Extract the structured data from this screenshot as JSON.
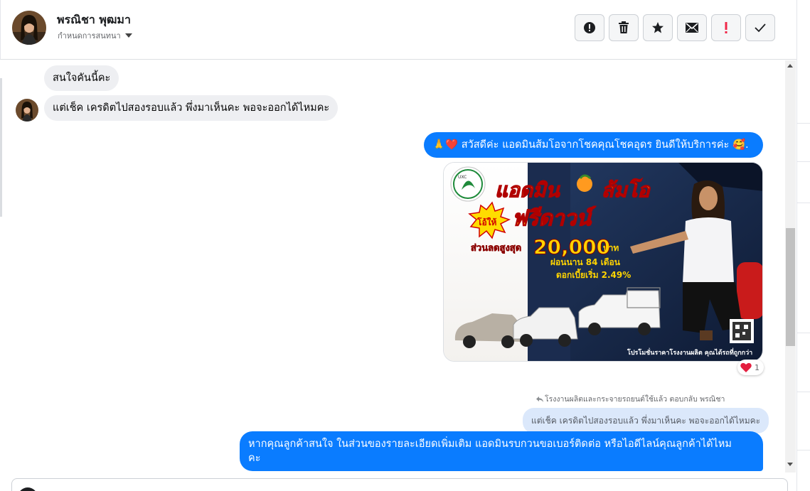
{
  "conversation": {
    "contact_name": "พรณิชา พุฒมา",
    "assign_label": "กำหนดการสนทนา"
  },
  "toolbar": {
    "buttons": [
      {
        "name": "spam-alert-icon",
        "color": "#1c1e21"
      },
      {
        "name": "trash-icon",
        "color": "#1c1e21"
      },
      {
        "name": "star-icon",
        "color": "#1c1e21"
      },
      {
        "name": "mail-icon",
        "color": "#1c1e21"
      },
      {
        "name": "exclamation-icon",
        "color": "#f02849"
      },
      {
        "name": "check-icon",
        "color": "#1c1e21"
      }
    ]
  },
  "messages": {
    "incoming_1": "สนใจคันนี้คะ",
    "incoming_2": "แต่เช็ค เครดิตไปสองรอบแล้ว พึ่งมาเห็นคะ พอจะออกได้ไหมคะ",
    "outgoing_greeting": "สวัสดีค่ะ แอดมินส้มโอจากโชคคุณโชคอุดร ยินดีให้บริการค่ะ",
    "outgoing_greeting_emoji_left": "🙏❤️",
    "outgoing_greeting_emoji_right": "🥰.",
    "reaction_count": "1",
    "reply_context": "โรงงานผลิตและกระจายรถยนต์ใช้แล้ว ตอบกลับ พรณิชา",
    "quoted_message": "แต่เช็ค เครดิตไปสองรอบแล้ว พึ่งมาเห็นคะ พอจะออกได้ไหมคะ",
    "outgoing_reply_line1": "หากคุณลูกค้าสนใจ ในส่วนของรายละเอียดเพิ่มเติม แอดมินรบกวนขอเบอร์ติดต่อ หรือไอดีไลน์คุณลูกค้าได้ไหม",
    "outgoing_reply_line2": "คะ"
  },
  "promo": {
    "logo_text": "UXC",
    "headline_1": "แอดมิน",
    "headline_2": "ส้มโอ",
    "burst": "โอ้ให้",
    "free_down": "ฟรีดาวน์",
    "discount_label": "ส่วนลดสูงสุด",
    "discount_amount": "20,000",
    "discount_unit": "บาท",
    "installment": "ผ่อนนาน 84 เดือน",
    "interest": "ดอกเบี้ยเริ่ม 2.49%",
    "footer": "โปรโมชั่นราคาโรงงานผลิต คุณได้รถที่ถูกกว่า"
  },
  "colors": {
    "accent": "#0a7cff",
    "incoming_bubble": "#eeeff2",
    "quote_bubble": "#dbe8fb",
    "reaction": "#e41e3f"
  }
}
